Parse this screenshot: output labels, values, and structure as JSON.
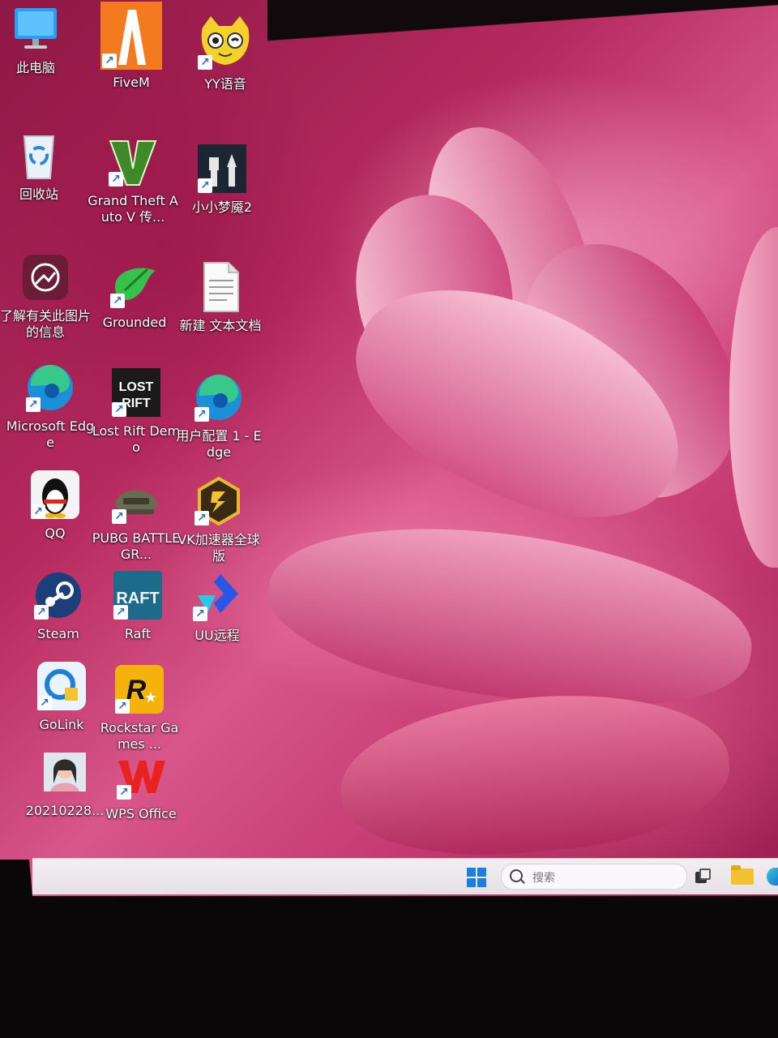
{
  "desktop": {
    "icons": [
      {
        "label": "此电脑",
        "icon": "computer-icon",
        "shortcut": false
      },
      {
        "label": "FiveM",
        "icon": "fivem-icon",
        "shortcut": true
      },
      {
        "label": "YY语音",
        "icon": "yy-voice-icon",
        "shortcut": true
      },
      {
        "label": "回收站",
        "icon": "recycle-bin-icon",
        "shortcut": false
      },
      {
        "label": "Grand Theft Auto V 传...",
        "icon": "gta-v-icon",
        "shortcut": true
      },
      {
        "label": "小小梦魇2",
        "icon": "little-nightmares-2-icon",
        "shortcut": true
      },
      {
        "label": "了解有关此图片的信息",
        "icon": "spotlight-info-icon",
        "shortcut": false
      },
      {
        "label": "Grounded",
        "icon": "grounded-icon",
        "shortcut": true
      },
      {
        "label": "新建 文本文档",
        "icon": "text-document-icon",
        "shortcut": false
      },
      {
        "label": "Microsoft Edge",
        "icon": "edge-icon",
        "shortcut": true
      },
      {
        "label": "Lost Rift Demo",
        "icon": "lost-rift-icon",
        "shortcut": true
      },
      {
        "label": "用户配置 1 - Edge",
        "icon": "edge-profile-icon",
        "shortcut": true
      },
      {
        "label": "QQ",
        "icon": "qq-penguin-icon",
        "shortcut": true
      },
      {
        "label": "PUBG BATTLEGR...",
        "icon": "pubg-helmet-icon",
        "shortcut": true
      },
      {
        "label": "VK加速器全球版",
        "icon": "vk-accelerator-icon",
        "shortcut": true
      },
      {
        "label": "Steam",
        "icon": "steam-icon",
        "shortcut": true
      },
      {
        "label": "Raft",
        "icon": "raft-icon",
        "shortcut": true
      },
      {
        "label": "UU远程",
        "icon": "uu-remote-icon",
        "shortcut": true
      },
      {
        "label": "GoLink",
        "icon": "golink-icon",
        "shortcut": true
      },
      {
        "label": "Rockstar Games ...",
        "icon": "rockstar-icon",
        "shortcut": true
      },
      {
        "label": "20210228...",
        "icon": "photo-thumbnail-icon",
        "shortcut": false
      },
      {
        "label": "WPS Office",
        "icon": "wps-office-icon",
        "shortcut": true
      }
    ]
  },
  "taskbar": {
    "search_placeholder": "搜索",
    "start_icon": "windows-start-icon",
    "pinned": [
      "task-view-icon",
      "file-explorer-icon",
      "edge-icon"
    ]
  },
  "colors": {
    "wallpaper_main": "#c43a70",
    "wallpaper_light": "#f2a8c4",
    "taskbar_bg": "#efe9ee",
    "start_blue": "#1a7fe0"
  }
}
